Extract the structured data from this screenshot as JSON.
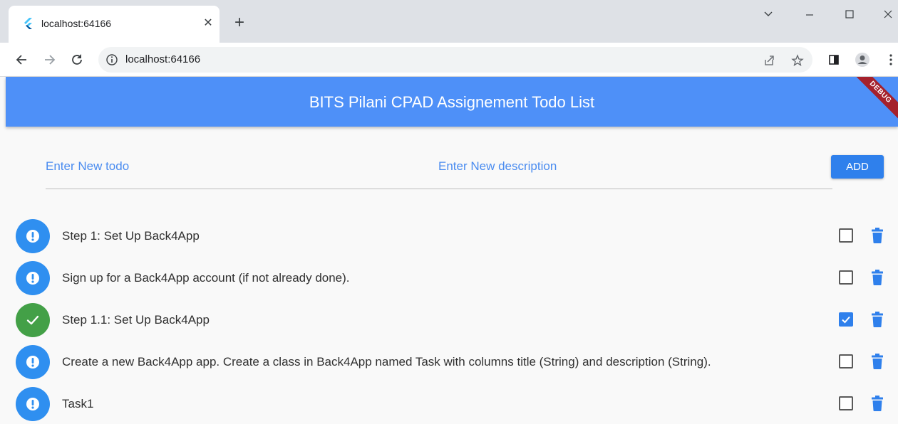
{
  "browser": {
    "tab_title": "localhost:64166",
    "url": "localhost:64166"
  },
  "app": {
    "title": "BITS Pilani CPAD Assignement Todo List",
    "debug_banner": "DEBUG",
    "primary_color": "#4e90f8"
  },
  "form": {
    "todo_placeholder": "Enter New todo",
    "description_placeholder": "Enter New description",
    "todo_value": "",
    "description_value": "",
    "add_label": "ADD"
  },
  "todos": [
    {
      "title": "Step 1: Set Up Back4App",
      "done": false
    },
    {
      "title": "Sign up for a Back4App account (if not already done).",
      "done": false
    },
    {
      "title": "Step 1.1: Set Up Back4App",
      "done": true
    },
    {
      "title": "Create a new Back4App app. Create a class in Back4App named Task with columns title (String) and description (String).",
      "done": false
    },
    {
      "title": "Task1",
      "done": false
    }
  ],
  "colors": {
    "pending": "#2f8ff0",
    "done": "#43a047",
    "delete_icon": "#2f80ec",
    "checkbox_checked": "#2f80ec"
  }
}
